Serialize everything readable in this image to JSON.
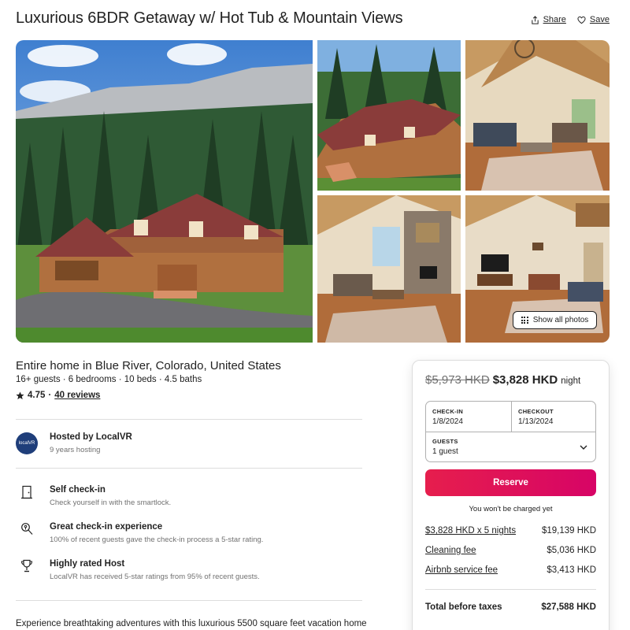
{
  "listing": {
    "title": "Luxurious 6BDR Getaway w/ Hot Tub & Mountain Views",
    "share_label": "Share",
    "save_label": "Save",
    "show_all_photos": "Show all photos",
    "home_type": "Entire home in Blue River, Colorado, United States",
    "meta": "16+ guests · 6 bedrooms · 10 beds · 4.5 baths",
    "rating": "4.75",
    "rating_sep": "·",
    "reviews": "40 reviews"
  },
  "host": {
    "avatar_text": "localVR",
    "name": "Hosted by LocalVR",
    "years": "9 years hosting"
  },
  "features": [
    {
      "icon": "door-icon",
      "title": "Self check-in",
      "desc": "Check yourself in with the smartlock."
    },
    {
      "icon": "key-search-icon",
      "title": "Great check-in experience",
      "desc": "100% of recent guests gave the check-in process a 5-star rating."
    },
    {
      "icon": "trophy-icon",
      "title": "Highly rated Host",
      "desc": "LocalVR has received 5-star ratings from 95% of recent guests."
    }
  ],
  "description": "Experience breathtaking adventures with this luxurious 5500 square feet vacation home",
  "booking": {
    "old_price": "$5,973 HKD",
    "new_price": "$3,828 HKD",
    "per": "night",
    "checkin_label": "CHECK-IN",
    "checkin_value": "1/8/2024",
    "checkout_label": "CHECKOUT",
    "checkout_value": "1/13/2024",
    "guests_label": "GUESTS",
    "guests_value": "1 guest",
    "reserve_label": "Reserve",
    "no_charge": "You won't be charged yet",
    "lines": [
      {
        "label": "$3,828 HKD x 5 nights",
        "amount": "$19,139 HKD"
      },
      {
        "label": "Cleaning fee",
        "amount": "$5,036 HKD"
      },
      {
        "label": "Airbnb service fee",
        "amount": "$3,413 HKD"
      }
    ],
    "total_label": "Total before taxes",
    "total_amount": "$27,588 HKD"
  },
  "colors": {
    "brand": "#e61e4d",
    "text": "#222222",
    "muted": "#717171"
  }
}
